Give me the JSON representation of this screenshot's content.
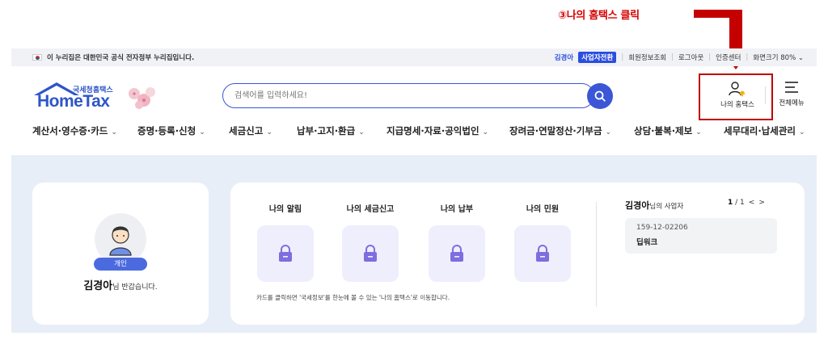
{
  "annotation": {
    "text": "③나의 홈택스 클릭"
  },
  "govbar": {
    "text": "이 누리집은 대한민국 공식 전자정부 누리집입니다.",
    "user_name": "김경아",
    "switch_label": "사업자전환",
    "member_info": "회원정보조회",
    "logout": "로그아웃",
    "cert": "인증센터",
    "screen_size": "화면크기 80%"
  },
  "header": {
    "logo_sub": "국세청홈택스",
    "logo_main": "HomeTax",
    "search_placeholder": "검색어를 입력하세요!",
    "my_hometax": "나의 홈택스",
    "all_menu": "전체메뉴"
  },
  "nav": {
    "items": [
      "계산서·영수증·카드",
      "증명·등록·신청",
      "세금신고",
      "납부·고지·환급",
      "지급명세·자료·공익법인",
      "장려금·연말정산·기부금",
      "상담·불복·제보",
      "세무대리·납세관리"
    ]
  },
  "profile": {
    "badge": "개인",
    "name": "김경아",
    "suffix": "님 반갑습니다."
  },
  "cards": {
    "items": [
      "나의 알림",
      "나의 세금신고",
      "나의 납부",
      "나의 민원"
    ],
    "notice": "카드를 클릭하면 '국세정보'를 한눈에 볼 수 있는 '나의 홈택스'로 이동합니다."
  },
  "business": {
    "owner": "김경아",
    "suffix": "님의 사업자",
    "page_current": "1",
    "page_total": "/ 1",
    "prev": "<",
    "next": ">",
    "reg_number": "159-12-02206",
    "name": "딥워크"
  },
  "colors": {
    "brand": "#3b56d6",
    "annotation": "#c00000",
    "background": "#e8eef8"
  }
}
